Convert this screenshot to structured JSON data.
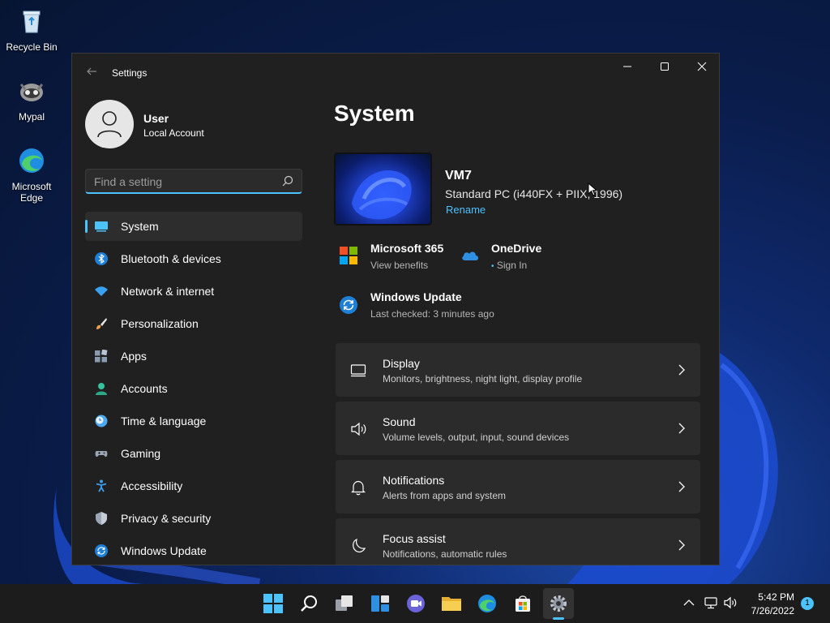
{
  "desktop": {
    "icons": [
      {
        "label": "Recycle Bin"
      },
      {
        "label": "Mypal"
      },
      {
        "label": "Microsoft Edge"
      }
    ]
  },
  "window": {
    "title": "Settings",
    "user": {
      "name": "User",
      "account_type": "Local Account"
    },
    "search": {
      "placeholder": "Find a setting"
    },
    "nav": [
      {
        "label": "System",
        "icon": "display-icon",
        "active": true
      },
      {
        "label": "Bluetooth & devices",
        "icon": "bluetooth-icon"
      },
      {
        "label": "Network & internet",
        "icon": "wifi-icon"
      },
      {
        "label": "Personalization",
        "icon": "brush-icon"
      },
      {
        "label": "Apps",
        "icon": "apps-icon"
      },
      {
        "label": "Accounts",
        "icon": "person-icon"
      },
      {
        "label": "Time & language",
        "icon": "clock-globe-icon"
      },
      {
        "label": "Gaming",
        "icon": "gamepad-icon"
      },
      {
        "label": "Accessibility",
        "icon": "accessibility-icon"
      },
      {
        "label": "Privacy & security",
        "icon": "shield-icon"
      },
      {
        "label": "Windows Update",
        "icon": "update-icon"
      }
    ],
    "main": {
      "title": "System",
      "device": {
        "name": "VM7",
        "model": "Standard PC (i440FX + PIIX, 1996)",
        "rename_label": "Rename"
      },
      "quick_links": [
        {
          "title": "Microsoft 365",
          "subtitle": "View benefits",
          "icon": "microsoft365-icon"
        },
        {
          "title": "OneDrive",
          "subtitle": "Sign In",
          "icon": "onedrive-icon"
        },
        {
          "title": "Windows Update",
          "subtitle": "Last checked: 3 minutes ago",
          "icon": "windows-update-icon"
        }
      ],
      "cards": [
        {
          "title": "Display",
          "subtitle": "Monitors, brightness, night light, display profile",
          "icon": "monitor-icon"
        },
        {
          "title": "Sound",
          "subtitle": "Volume levels, output, input, sound devices",
          "icon": "speaker-icon"
        },
        {
          "title": "Notifications",
          "subtitle": "Alerts from apps and system",
          "icon": "bell-icon"
        },
        {
          "title": "Focus assist",
          "subtitle": "Notifications, automatic rules",
          "icon": "moon-icon"
        }
      ]
    }
  },
  "taskbar": {
    "apps": [
      "start",
      "search",
      "task-view",
      "widgets",
      "chat",
      "file-explorer",
      "edge",
      "store",
      "settings"
    ],
    "active_app": "settings",
    "clock": {
      "time": "5:42 PM",
      "date": "7/26/2022"
    },
    "notification_count": "1"
  },
  "colors": {
    "accent": "#4cc2ff",
    "window_bg": "#202020",
    "card_bg": "#2b2b2b"
  }
}
